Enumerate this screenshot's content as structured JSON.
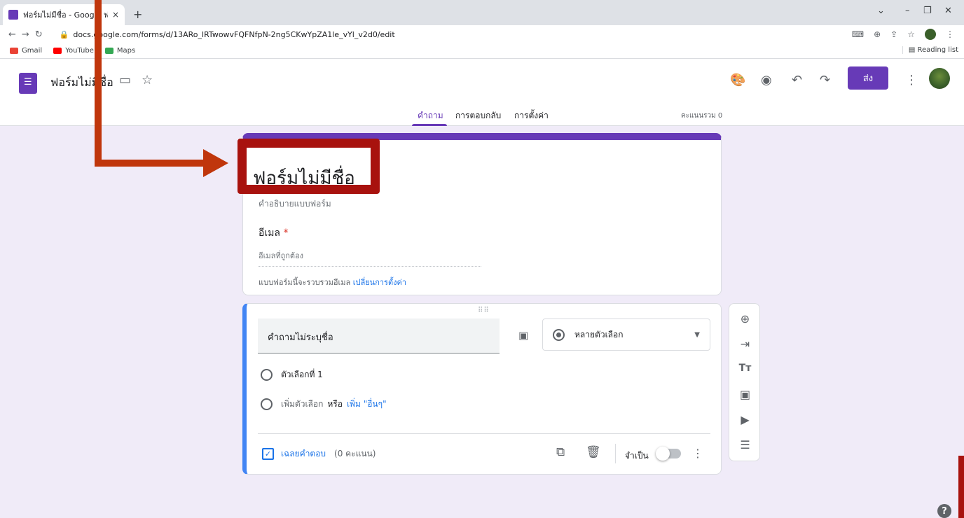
{
  "browser": {
    "tab_title": "ฟอร์มไม่มีชื่อ - Google ฟอร์ม",
    "tab_close": "×",
    "new_tab": "+",
    "url": "docs.google.com/forms/d/13ARo_lRTwowvFQFNfpN-2ng5CKwYpZA1le_vYl_v2d0/edit",
    "bookmarks": [
      {
        "label": "Gmail",
        "color": "#ea4335"
      },
      {
        "label": "YouTube",
        "color": "#ff0000"
      },
      {
        "label": "Maps",
        "color": "#34a853"
      }
    ],
    "reading_list": "Reading list"
  },
  "header": {
    "doc_title": "ฟอร์มไม่มีชื่อ",
    "send_label": "ส่ง",
    "tabs": [
      "คำถาม",
      "การตอบกลับ",
      "การตั้งค่า"
    ],
    "active_tab": 0,
    "total_score": "คะแนนรวม 0"
  },
  "form": {
    "title": "ฟอร์มไม่มีชื่อ",
    "description": "คำอธิบายแบบฟอร์ม",
    "email_label": "อีเมล",
    "required_mark": "*",
    "email_placeholder": "อีเมลที่ถูกต้อง",
    "email_note": "แบบฟอร์มนี้จะรวบรวมอีเมล",
    "email_note_link": "เปลี่ยนการตั้งค่า"
  },
  "question": {
    "title": "คำถามไม่ระบุชื่อ",
    "type": "หลายตัวเลือก",
    "option1": "ตัวเลือกที่ 1",
    "add_option": "เพิ่มตัวเลือก",
    "or_word": "หรือ",
    "add_other": "เพิ่ม \"อื่นๆ\"",
    "answer_key": "เฉลยคำตอบ",
    "points": "(0 คะแนน)",
    "required_label": "จำเป็น",
    "required_on": false
  },
  "colors": {
    "accent": "#673ab7",
    "question_border": "#4285f4",
    "annotation": "#c0360c"
  }
}
